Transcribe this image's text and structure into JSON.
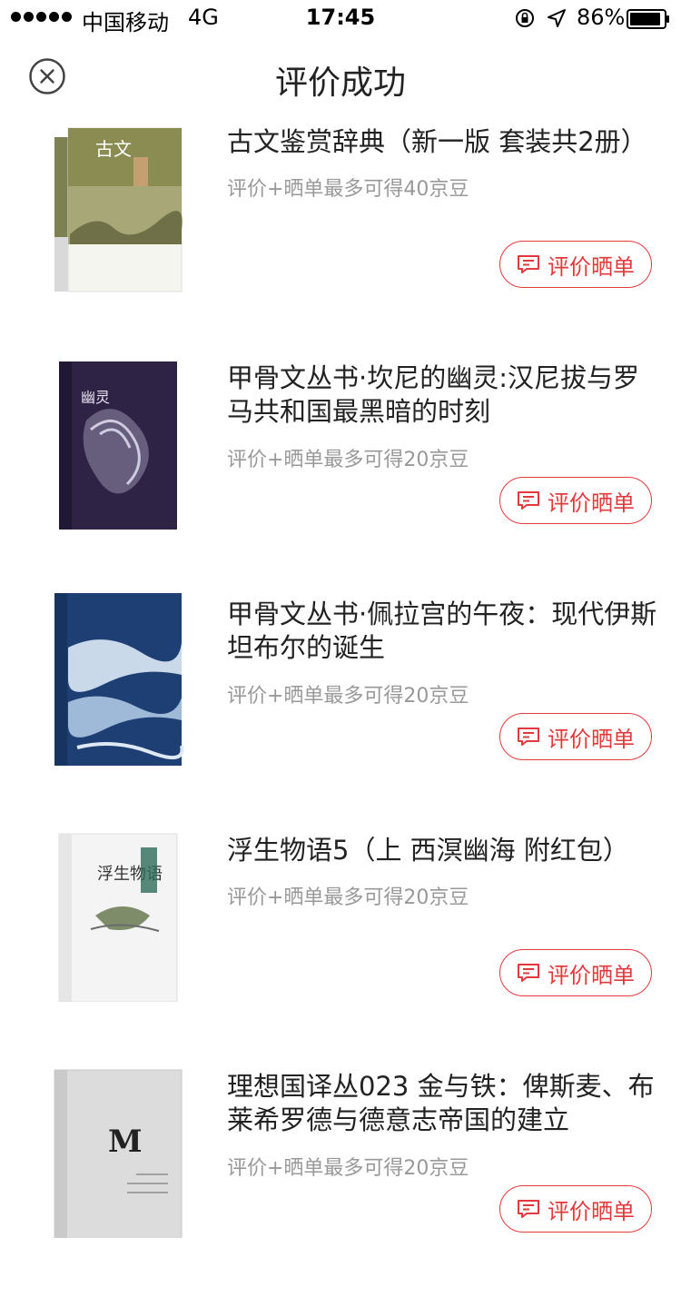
{
  "status": {
    "carrier": "中国移动",
    "network": "4G",
    "time": "17:45",
    "battery": "86%"
  },
  "header": {
    "title": "评价成功"
  },
  "items": [
    {
      "title": "古文鉴赏辞典（新一版 套装共2册）",
      "subtitle": "评价+晒单最多可得40京豆",
      "button_label": "评价晒单",
      "cover_text": "古文"
    },
    {
      "title": "甲骨文丛书·坎尼的幽灵:汉尼拔与罗马共和国最黑暗的时刻",
      "subtitle": "评价+晒单最多可得20京豆",
      "button_label": "评价晒单",
      "cover_text": "幽灵"
    },
    {
      "title": "甲骨文丛书·佩拉宫的午夜：现代伊斯坦布尔的诞生",
      "subtitle": "评价+晒单最多可得20京豆",
      "button_label": "评价晒单",
      "cover_text": ""
    },
    {
      "title": "浮生物语5（上 西溟幽海 附红包）",
      "subtitle": "评价+晒单最多可得20京豆",
      "button_label": "评价晒单",
      "cover_text": "浮生物语"
    },
    {
      "title": "理想国译丛023 金与铁：俾斯麦、布莱希罗德与德意志帝国的建立",
      "subtitle": "评价+晒单最多可得20京豆",
      "button_label": "评价晒单",
      "cover_text": "M"
    }
  ]
}
